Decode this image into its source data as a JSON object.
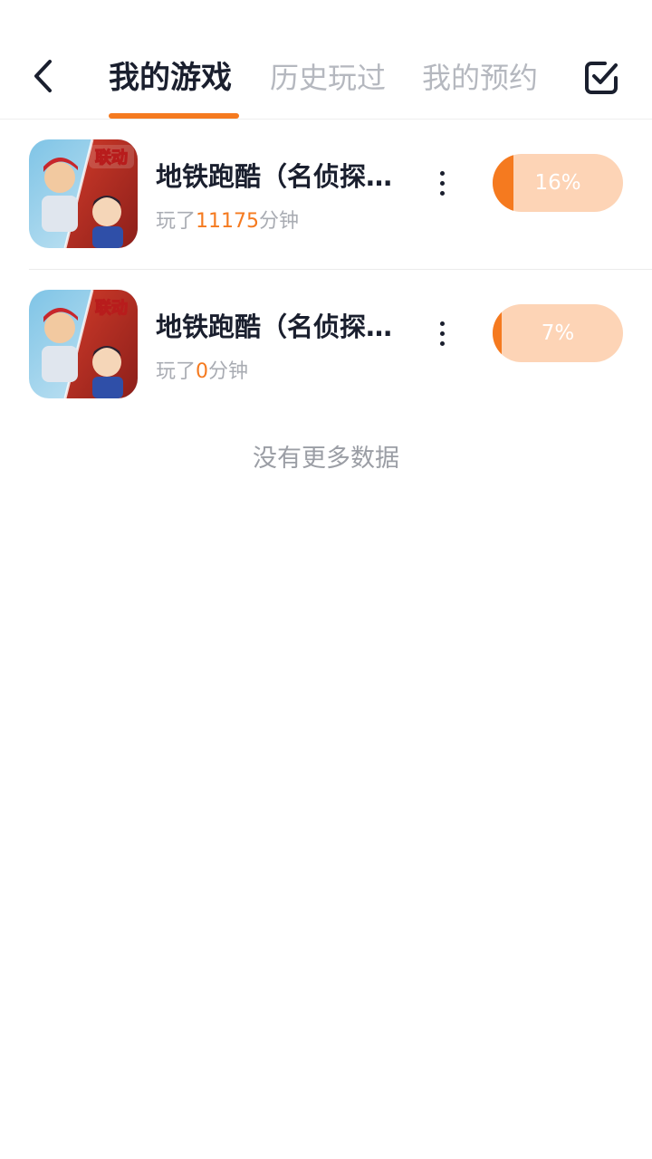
{
  "colors": {
    "accent": "#f57a1f",
    "progress_bg": "#fdd4b6",
    "text_primary": "#1a1f2e",
    "text_muted": "#b5b8bf"
  },
  "header": {
    "back_icon": "chevron-left-icon",
    "tabs": [
      {
        "label": "我的游戏",
        "active": true
      },
      {
        "label": "历史玩过",
        "active": false
      },
      {
        "label": "我的预约",
        "active": false
      }
    ],
    "manage_icon": "checkbox-icon"
  },
  "games": [
    {
      "title": "地铁跑酷（名侦探柯南联动）",
      "played_prefix": "玩了",
      "played_minutes": "11175",
      "played_suffix": "分钟",
      "progress_label": "16%",
      "progress_value": 0.16,
      "icon_badge": "联动",
      "menu_icon": "more-vertical-icon"
    },
    {
      "title": "地铁跑酷（名侦探柯南联动）",
      "played_prefix": "玩了",
      "played_minutes": "0",
      "played_suffix": "分钟",
      "progress_label": "7%",
      "progress_value": 0.07,
      "icon_badge": "联动",
      "menu_icon": "more-vertical-icon"
    }
  ],
  "footer": {
    "no_more_text": "没有更多数据"
  }
}
